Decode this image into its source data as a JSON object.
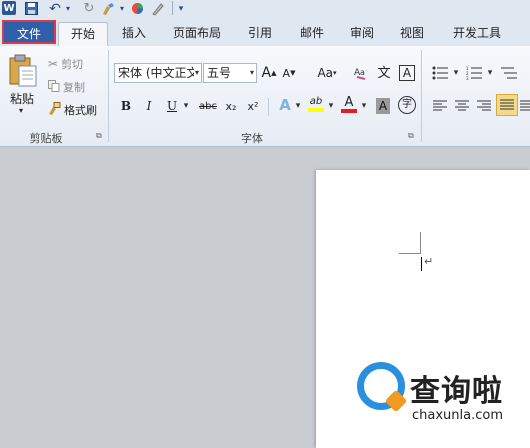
{
  "app": {
    "logo_letter": "W"
  },
  "qat": {
    "undo": "↶",
    "redo": "↻",
    "dropdown": "▾"
  },
  "tabs": {
    "file": "文件",
    "items": [
      "开始",
      "插入",
      "页面布局",
      "引用",
      "邮件",
      "审阅",
      "视图",
      "开发工具"
    ],
    "active": "开始"
  },
  "clipboard": {
    "paste": "粘贴",
    "cut": "剪切",
    "copy": "复制",
    "format_painter": "格式刷",
    "group_label": "剪贴板"
  },
  "font": {
    "family": "宋体 (中文正文",
    "size": "五号",
    "grow": "A",
    "shrink": "A",
    "change_case": "Aa",
    "phonetic": "文",
    "border": "A",
    "bold": "B",
    "italic": "I",
    "underline": "U",
    "strike": "abc",
    "subscript": "x₂",
    "superscript": "x²",
    "effects": "A",
    "highlight": "ab",
    "color": "A",
    "shading": "A",
    "enclose": "字",
    "group_label": "字体"
  },
  "document": {
    "paragraph_mark": "↵"
  },
  "watermark": {
    "title": "查询啦",
    "url": "chaxunla.com"
  },
  "colors": {
    "file_tab": "#2f5fa8",
    "file_tab_border": "#d63b4a",
    "watermark_blue": "#2b8fe0",
    "watermark_orange": "#f29a1f"
  }
}
